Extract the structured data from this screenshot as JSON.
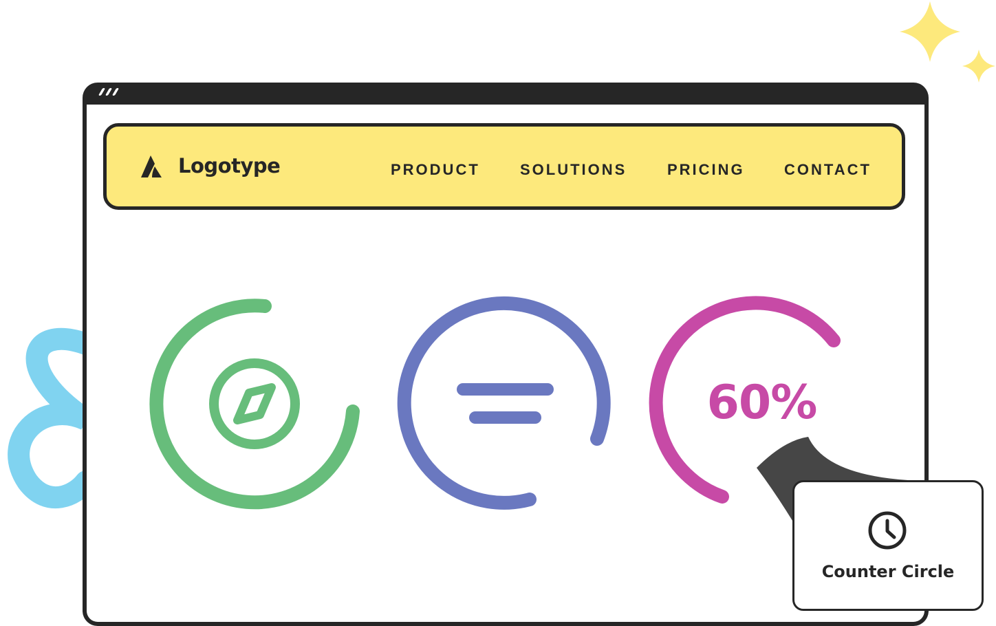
{
  "brand": {
    "name": "Logotype",
    "logo_icon": "logotype-mark-icon"
  },
  "nav": {
    "items": [
      {
        "label": "PRODUCT"
      },
      {
        "label": "SOLUTIONS"
      },
      {
        "label": "PRICING"
      },
      {
        "label": "CONTACT"
      }
    ]
  },
  "counters": [
    {
      "icon": "compass-icon",
      "color": "#67bd7b"
    },
    {
      "icon": "menu-lines-icon",
      "color": "#6a78c0"
    },
    {
      "value_text": "60%",
      "value": 60,
      "color": "#c74aa6"
    }
  ],
  "widget": {
    "icon": "clock-icon",
    "label": "Counter Circle"
  },
  "colors": {
    "navbar": "#fde97c",
    "frame": "#262626",
    "scribble": "#80d3f0",
    "sparkle": "#fde97c"
  }
}
